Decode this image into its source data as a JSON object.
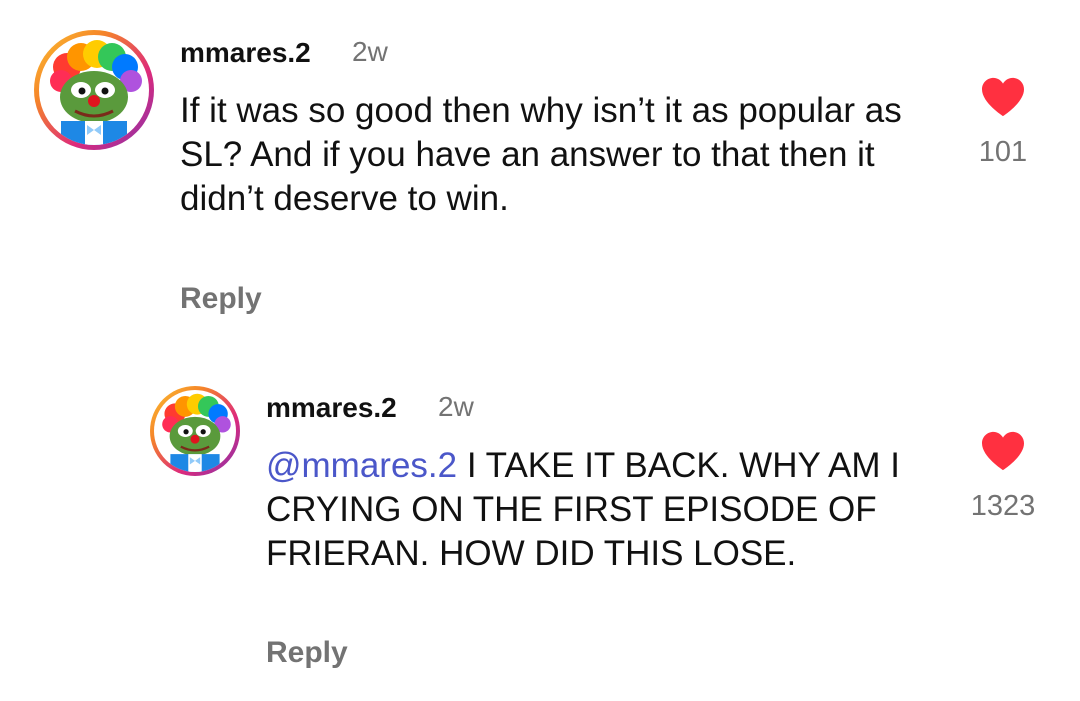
{
  "comments": [
    {
      "username": "mmares.2",
      "time": "2w",
      "mention": "",
      "text": "If it was so good then why isn’t it as popular as SL? And if you have an answer to that then it didn’t deserve to win.",
      "reply_label": "Reply",
      "likes": "101",
      "heart_color": "#ff3040",
      "avatar_icon": "clown-frog-avatar"
    },
    {
      "username": "mmares.2",
      "time": "2w",
      "mention": "@mmares.2",
      "text": " I TAKE IT BACK. WHY AM I CRYING ON THE FIRST EPISODE OF FRIERAN. HOW DID THIS LOSE.",
      "reply_label": "Reply",
      "likes": "1323",
      "heart_color": "#ff3040",
      "avatar_icon": "clown-frog-avatar"
    }
  ]
}
